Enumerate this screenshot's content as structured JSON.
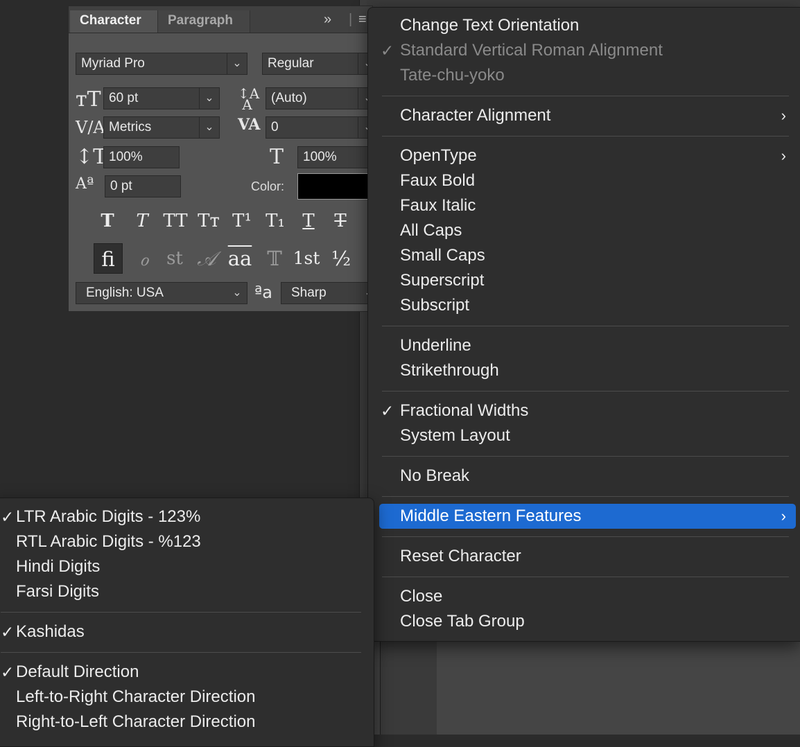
{
  "character_panel": {
    "tabs": [
      "Character",
      "Paragraph"
    ],
    "font_family": "Myriad Pro",
    "font_style": "Regular",
    "font_size": "60 pt",
    "leading": "(Auto)",
    "kerning": "Metrics",
    "tracking": "0",
    "vertical_scale": "100%",
    "horizontal_scale": "100%",
    "baseline_shift": "0 pt",
    "color_label": "Color:",
    "color_value": "#000000",
    "language": "English: USA",
    "antialias_icon_text": "ªa",
    "antialias": "Sharp",
    "collapse_glyph": "»",
    "menu_glyph": "≡",
    "style_buttons": [
      "T",
      "T",
      "TT",
      "Tт",
      "T¹",
      "T₁",
      "T",
      "T"
    ],
    "opentype_buttons": [
      "fi",
      "ℴ",
      "st",
      "𝒜",
      "aa",
      "𝕋",
      "1st",
      "½"
    ]
  },
  "main_menu": {
    "groups": [
      [
        {
          "label": "Change Text Orientation",
          "checked": false,
          "disabled": false,
          "submenu": false
        },
        {
          "label": "Standard Vertical Roman Alignment",
          "checked": true,
          "disabled": true,
          "submenu": false
        },
        {
          "label": "Tate-chu-yoko",
          "checked": false,
          "disabled": true,
          "submenu": false
        }
      ],
      [
        {
          "label": "Character Alignment",
          "checked": false,
          "disabled": false,
          "submenu": true
        }
      ],
      [
        {
          "label": "OpenType",
          "checked": false,
          "disabled": false,
          "submenu": true
        },
        {
          "label": "Faux Bold",
          "checked": false,
          "disabled": false,
          "submenu": false
        },
        {
          "label": "Faux Italic",
          "checked": false,
          "disabled": false,
          "submenu": false
        },
        {
          "label": "All Caps",
          "checked": false,
          "disabled": false,
          "submenu": false
        },
        {
          "label": "Small Caps",
          "checked": false,
          "disabled": false,
          "submenu": false
        },
        {
          "label": "Superscript",
          "checked": false,
          "disabled": false,
          "submenu": false
        },
        {
          "label": "Subscript",
          "checked": false,
          "disabled": false,
          "submenu": false
        }
      ],
      [
        {
          "label": "Underline",
          "checked": false,
          "disabled": false,
          "submenu": false
        },
        {
          "label": "Strikethrough",
          "checked": false,
          "disabled": false,
          "submenu": false
        }
      ],
      [
        {
          "label": "Fractional Widths",
          "checked": true,
          "disabled": false,
          "submenu": false
        },
        {
          "label": "System Layout",
          "checked": false,
          "disabled": false,
          "submenu": false
        }
      ],
      [
        {
          "label": "No Break",
          "checked": false,
          "disabled": false,
          "submenu": false
        }
      ],
      [
        {
          "label": "Middle Eastern Features",
          "checked": false,
          "disabled": false,
          "submenu": true,
          "highlighted": true
        }
      ],
      [
        {
          "label": "Reset Character",
          "checked": false,
          "disabled": false,
          "submenu": false
        }
      ],
      [
        {
          "label": "Close",
          "checked": false,
          "disabled": false,
          "submenu": false
        },
        {
          "label": "Close Tab Group",
          "checked": false,
          "disabled": false,
          "submenu": false
        }
      ]
    ],
    "check_glyph": "✓",
    "submenu_glyph": "›",
    "highlight_color": "#1d6ad1"
  },
  "middle_eastern_submenu": {
    "groups": [
      [
        {
          "label": "LTR Arabic Digits - 123%",
          "checked": true
        },
        {
          "label": "RTL Arabic Digits - %123",
          "checked": false
        },
        {
          "label": "Hindi Digits",
          "checked": false
        },
        {
          "label": "Farsi Digits",
          "checked": false
        }
      ],
      [
        {
          "label": "Kashidas",
          "checked": true
        }
      ],
      [
        {
          "label": "Default Direction",
          "checked": true
        },
        {
          "label": "Left-to-Right Character Direction",
          "checked": false
        },
        {
          "label": "Right-to-Left Character Direction",
          "checked": false
        }
      ]
    ]
  }
}
